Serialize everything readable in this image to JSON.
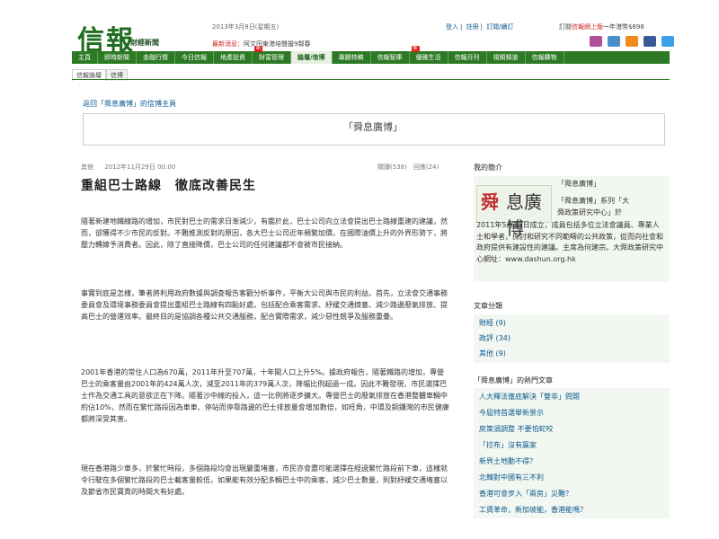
{
  "header": {
    "logo_main": "信報",
    "logo_sub": "財經新聞",
    "date": "2013年3月8日(星期五)",
    "latest_label": "最新消息：",
    "latest_text": "阿文田東港培聲援9鄰春",
    "top_links": [
      "登入",
      "註冊",
      "訂閱/續訂"
    ],
    "sub_promo_prefix": "訂閱",
    "sub_promo_highlight": "信報網上版",
    "sub_promo_suffix": "一年港幣$698",
    "icon_colors": [
      "#b0509a",
      "#4a8fc7",
      "#f08a1c",
      "#3b5998",
      "#3aa0e8"
    ]
  },
  "nav": {
    "items": [
      {
        "label": "主頁",
        "new": false,
        "active": false
      },
      {
        "label": "即時新聞",
        "new": false,
        "active": false
      },
      {
        "label": "金融行情",
        "new": false,
        "active": false
      },
      {
        "label": "今日信報",
        "new": false,
        "active": false
      },
      {
        "label": "地產投資",
        "new": false,
        "active": false
      },
      {
        "label": "財富管理",
        "new": true,
        "active": false
      },
      {
        "label": "論壇/信博",
        "new": false,
        "active": true
      },
      {
        "label": "專題特稿",
        "new": false,
        "active": false
      },
      {
        "label": "信報智庫",
        "new": false,
        "active": false
      },
      {
        "label": "優雅生活",
        "new": true,
        "active": false
      },
      {
        "label": "信報月刊",
        "new": false,
        "active": false
      },
      {
        "label": "視頻頻道",
        "new": false,
        "active": false
      },
      {
        "label": "信報購物",
        "new": false,
        "active": false
      }
    ],
    "new_badge": "新",
    "subnav": [
      "信報論壇",
      "信博"
    ]
  },
  "blog": {
    "back_link": "返回「舜息廣博」的信博主頁",
    "title": "「舜息廣博」"
  },
  "article": {
    "category": "其他",
    "datetime": "2012年11月29日 00:00",
    "stats": "閱讀(538)　回應(24)",
    "headline": "重組巴士路線　徹底改善民生",
    "paragraphs": [
      "隨著新建地鐵線路的增加，市民對巴士的需求日漸減少，有鑑於此，巴士公司向立法會提出巴士路線重建的建議，然而，卻獲得不少市民的反對。不難推測反對的原因，各大巴士公司近年頻繁加價，在國際油價上升的外界形勢下，將壓力轉嫁予消費者。因此，除了直接降價，巴士公司的任何建議都不會被市民接納。",
      "事實到底是怎樣，筆者將利用政府數據與調查報告客觀分析事件，平衡大公司與市民的利益。首先，立法會交通事務委員會及環境事務委員會提出重組巴士路線有四點好處，包括配合乘客需求、紓緩交通擠塞、減少路邊廢氣排放、提高巴士的營運效率。最終目的是協調各種公共交通服務，配合實際需求，減少惡性競爭及服務重疊。",
      "2001年香港的常住人口為670萬，2011年升至707萬，十年間人口上升5%。據政府報告，隨著鐵路的增加，專營巴士的乘客量由2001年的424萬人次，減至2011年的379萬人次，降幅比例超過一成。因此不難發現，市民選擇巴士作為交通工具的意欲正在下降。隨著沙中線的投入，這一比例將逐步擴大。專營巴士的廢氣排放在香港整體車輛中約佔10%，然而在繁忙路段因為車車、停站而停靠路邊的巴士排放量會增加數倍，如旺角，中環及銅鑼灣的市民健康都將深受其害。",
      "現在香港路少車多，於繁忙時段，多個路段均會出現嚴重堵塞，市民亦會盡可能選擇在經過繁忙路段前下車，這樣就令行駛在多個繁忙路段的巴士載客量較低，如果能有效分配多輛巴士中的乘客，減少巴士數量，則對紓緩交通堵塞以及節省市民寶貴的時間大有好處。"
    ]
  },
  "sidebar": {
    "profile_heading": "我的簡介",
    "profile_img_a": "舜",
    "profile_img_b": "息廣博",
    "profile_name": "「舜息廣博」",
    "profile_desc_1": "「舜息廣博」系列「大",
    "profile_desc_2": "舜政策研究中心」於",
    "profile_desc_rest": "2011年5月12日成立，成員包括多位立法會議員、專業人士和學者，探討和研究不同範疇的公共政策，從而向社會和政府提供有建設性的建議。主席為何建宗。大舜政策研究中心網址：www.dashun.org.hk",
    "categories_heading": "文章分類",
    "categories": [
      "財經 (9)",
      "政評 (34)",
      "其他 (9)"
    ],
    "hot_heading": "「舜息廣博」的熱門文章",
    "hot_articles": [
      "人大釋法徹底解決「雙非」問題",
      "今屆特首選舉新景示",
      "房策須調整 不要怕蛇咬",
      "「拉布」沒有贏家",
      "新界土地動不得？",
      "北韓對中國有三不利",
      "香港可會步入「兩房」災難？",
      "工資革命，新加坡能，香港能嗎？"
    ]
  }
}
